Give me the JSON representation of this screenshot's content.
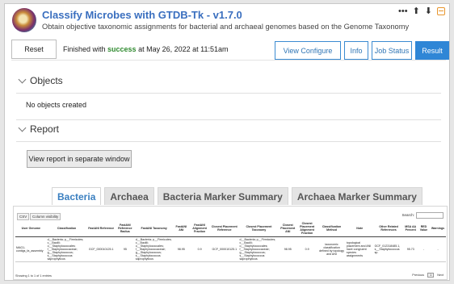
{
  "app": {
    "title": "Classify Microbes with GTDB-Tk - v1.7.0",
    "subtitle": "Obtain objective taxonomic assignments for bacterial and archaeal genomes based on the Genome Taxonomy",
    "controls": {
      "more": "•••",
      "up": "⬆",
      "down": "⬇"
    }
  },
  "toolbar": {
    "reset_label": "Reset",
    "status_prefix": "Finished with ",
    "status_word": "success",
    "status_suffix": " at May 26, 2022 at 11:51am",
    "tabs": [
      "View Configure",
      "Info",
      "Job Status",
      "Result"
    ],
    "active_tab": "Result",
    "accent": "#2f86d6"
  },
  "objects": {
    "heading": "Objects",
    "empty_text": "No objects created"
  },
  "report": {
    "heading": "Report",
    "open_button": "View report in separate window",
    "tabs": [
      "Bacteria",
      "Archaea",
      "Bacteria Marker Summary",
      "Archaea Marker Summary"
    ],
    "active_tab": "Bacteria",
    "table": {
      "buttons": [
        "CSV",
        "Column visibility"
      ],
      "search_label": "Search:",
      "columns": [
        "User Genome",
        "Classification",
        "FastANI Reference",
        "FastANI Reference Radius",
        "FastANI Taxonomy",
        "FastANI ANI",
        "FastANI Alignment Fraction",
        "Closest Placement Reference",
        "Closest Placement Taxonomy",
        "Closest Placement ANI",
        "Closest Placement Alignment Fraction",
        "Classification Method",
        "Note",
        "Other Related References",
        "MSA AA Percent",
        "RED Value",
        "Warnings"
      ],
      "rows": [
        [
          "MAG1-contigs_fa_assembly",
          "d__Bacteria; p__Firmicutes; c__Bacilli; o__Staphylococcales; f__Staphylococcaceae; g__Staphylococcus; s__Staphylococcus saprophyticus",
          "GCF_000010125.1",
          "95",
          "d__Bacteria; p__Firmicutes; c__Bacilli; o__Staphylococcales; f__Staphylococcaceae; g__Staphylococcus; s__Staphylococcus saprophyticus",
          "98.95",
          "0.9",
          "GCF_000010125.1",
          "d__Bacteria; p__Firmicutes; c__Bacilli; o__Staphylococcales; f__Staphylococcaceae; g__Staphylococcus; s__Staphylococcus saprophyticus",
          "98.95",
          "0.9",
          "taxonomic classification defined by topology and ANI",
          "topological placement and ANI have congruent species assignments",
          "GCF_012318485.1, s__Staphylococcus sp.",
          "95.73",
          "-",
          "-"
        ]
      ],
      "footer_left": "Showing 1 to 1 of 1 entries",
      "pagination": [
        "Previous",
        "1",
        "Next"
      ]
    }
  }
}
